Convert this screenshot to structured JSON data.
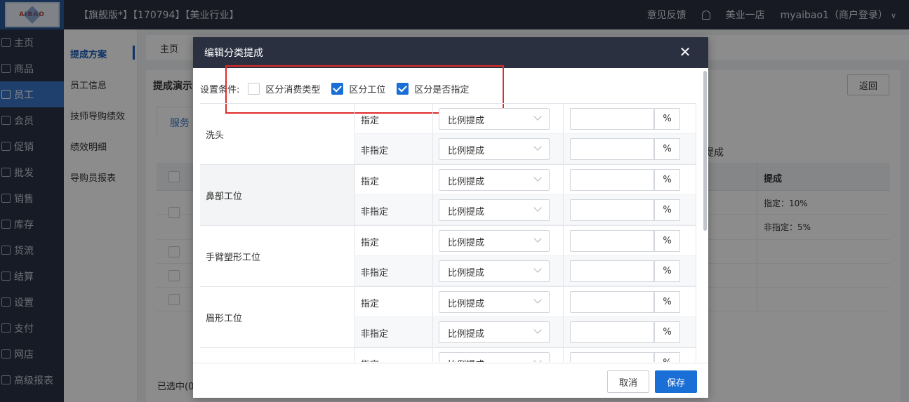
{
  "header": {
    "logo_text": "AIBAO",
    "title": "【旗舰版*】【170794】【美业行业】",
    "feedback": "意见反馈",
    "store": "美业一店",
    "user": "myaibao1（商户登录）"
  },
  "sidebar": {
    "items": [
      {
        "label": "主页",
        "icon": "home-icon"
      },
      {
        "label": "商品",
        "icon": "goods-icon"
      },
      {
        "label": "员工",
        "icon": "staff-icon"
      },
      {
        "label": "会员",
        "icon": "member-icon"
      },
      {
        "label": "促销",
        "icon": "promo-icon"
      },
      {
        "label": "批发",
        "icon": "wholesale-icon"
      },
      {
        "label": "销售",
        "icon": "sales-icon"
      },
      {
        "label": "库存",
        "icon": "stock-icon"
      },
      {
        "label": "货流",
        "icon": "logistics-icon"
      },
      {
        "label": "结算",
        "icon": "settle-icon"
      },
      {
        "label": "设置",
        "icon": "settings-icon"
      },
      {
        "label": "支付",
        "icon": "pay-icon"
      },
      {
        "label": "网店",
        "icon": "shop-icon"
      },
      {
        "label": "高级报表",
        "icon": "report-icon"
      }
    ],
    "active_index": 2
  },
  "subnav": {
    "items": [
      "提成方案",
      "员工信息",
      "技师导购绩效",
      "绩效明细",
      "导购员报表"
    ]
  },
  "background": {
    "home_tab": "主页",
    "panel_title": "提成演示",
    "back_button": "返回",
    "service_tab": "服务",
    "second_tab": "提成",
    "col_title": "提成",
    "cell_1": "指定：10%",
    "cell_2": "非指定：5%",
    "footer": "已选中(0)"
  },
  "modal": {
    "title": "编辑分类提成",
    "condition_label": "设置条件:",
    "conditions": [
      {
        "label": "区分消费类型",
        "checked": false
      },
      {
        "label": "区分工位",
        "checked": true
      },
      {
        "label": "区分是否指定",
        "checked": true
      }
    ],
    "groups": [
      {
        "name": "洗头"
      },
      {
        "name": "鼻部工位"
      },
      {
        "name": "手臂塑形工位"
      },
      {
        "name": "眉形工位"
      },
      {
        "name": ""
      }
    ],
    "sub_labels": {
      "designated": "指定",
      "non_designated": "非指定"
    },
    "select_value": "比例提成",
    "percent_unit": "%",
    "cancel": "取消",
    "save": "保存"
  },
  "colors": {
    "accent": "#1a6fd6",
    "header_bg": "#2a3040",
    "highlight": "#e02a2a"
  }
}
